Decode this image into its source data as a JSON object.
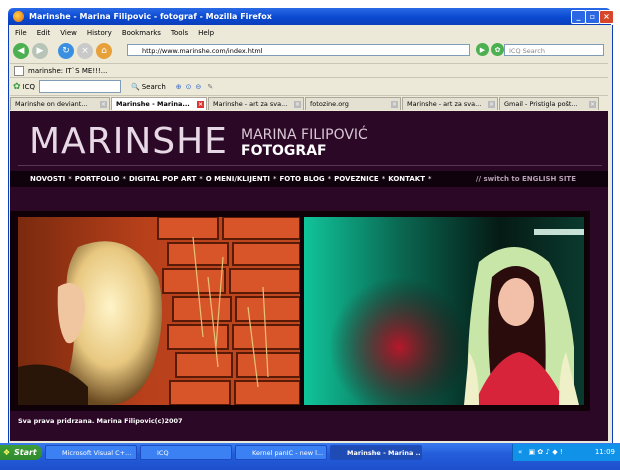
{
  "window": {
    "title": "Marinshe - Marina Filipovic - fotograf - Mozilla Firefox",
    "min": "_",
    "max": "▫",
    "close": "×"
  },
  "menubar": [
    "File",
    "Edit",
    "View",
    "History",
    "Bookmarks",
    "Tools",
    "Help"
  ],
  "navbar": {
    "url": "http://www.marinshe.com/index.html",
    "search_placeholder": "ICQ Search"
  },
  "bookmarks": {
    "item": "marinshe: IT`S ME!!!..."
  },
  "icqbar": {
    "label": "ICQ",
    "search_label": "Search"
  },
  "tabs": [
    {
      "label": "Marinshe on deviant..."
    },
    {
      "label": "Marinshe - Marina..."
    },
    {
      "label": "Marinshe - art za sva..."
    },
    {
      "label": "fotozine.org"
    },
    {
      "label": "Marinshe - art za sva..."
    },
    {
      "label": "Gmail - Pristigla pošt..."
    }
  ],
  "page": {
    "brand": "MARINSHE",
    "name": "MARINA FILIPOVIĆ",
    "role": "FOTOGRAF",
    "menu": [
      "NOVOSTI",
      "PORTFOLIO",
      "DIGITAL POP ART",
      "O MENI/KLIJENTI",
      "FOTO BLOG",
      "POVEZNICE",
      "KONTAKT"
    ],
    "menu_sep": "*",
    "switch": "// switch to ENGLISH SITE",
    "copyright": "Sva prava pridrzana. Marina Filipovic(c)2007"
  },
  "taskbar": {
    "start": "Start",
    "items": [
      {
        "label": "Microsoft Visual C+..."
      },
      {
        "label": "ICQ"
      },
      {
        "label": "Kernel panIC - new l..."
      },
      {
        "label": "Marinshe - Marina ..."
      }
    ],
    "tray_prefix": "«",
    "time": "11:09"
  },
  "colors": {
    "page_bg": "#2b0826",
    "menu_bg": "#0f020c",
    "titlebar": "#0a49d0"
  }
}
